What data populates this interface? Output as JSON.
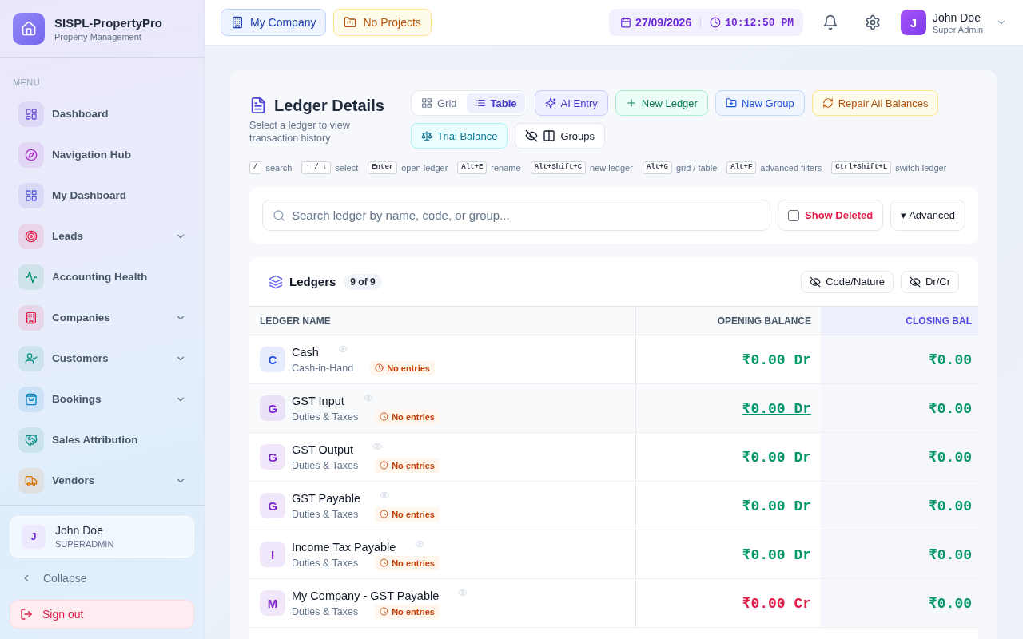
{
  "sidebar": {
    "brand": {
      "title": "SISPL-PropertyPro",
      "subtitle": "Property Management"
    },
    "section": "MENU",
    "items": [
      {
        "label": "Dashboard",
        "color": "#6d4fd8",
        "submenu": false,
        "selected": false
      },
      {
        "label": "Navigation Hub",
        "color": "#b02fc9",
        "submenu": false,
        "selected": false
      },
      {
        "label": "My Dashboard",
        "color": "#5b5bd6",
        "submenu": false,
        "selected": false
      },
      {
        "label": "Leads",
        "color": "#e11d48",
        "submenu": true,
        "selected": false
      },
      {
        "label": "Accounting Health",
        "color": "#059669",
        "submenu": false,
        "selected": false
      },
      {
        "label": "Companies",
        "color": "#e11d48",
        "submenu": true,
        "selected": false
      },
      {
        "label": "Customers",
        "color": "#0d9488",
        "submenu": true,
        "selected": false
      },
      {
        "label": "Bookings",
        "color": "#0284c7",
        "submenu": true,
        "selected": false
      },
      {
        "label": "Sales Attribution",
        "color": "#0d9488",
        "submenu": false,
        "selected": false
      },
      {
        "label": "Vendors",
        "color": "#d97706",
        "submenu": true,
        "selected": false
      }
    ],
    "user": {
      "initial": "J",
      "name": "John Doe",
      "role": "SUPERADMIN"
    },
    "collapse": "Collapse",
    "sign_out": "Sign out"
  },
  "topbar": {
    "company": "My Company",
    "project": "No Projects",
    "date": "27/09/2026",
    "time": "10:12:50 PM",
    "user": {
      "initial": "J",
      "name": "John Doe",
      "role": "Super Admin"
    }
  },
  "page": {
    "title": "Ledger Details",
    "subtitle": "Select a ledger to view transaction history",
    "view_modes": [
      {
        "label": "Grid",
        "kind": "grid",
        "selected": false
      },
      {
        "label": "Table",
        "kind": "table",
        "selected": true
      }
    ],
    "actions": [
      {
        "label": "AI Entry",
        "kind": "ai"
      },
      {
        "label": "New Ledger",
        "kind": "add"
      },
      {
        "label": "New Group",
        "kind": "folder"
      },
      {
        "label": "Repair All Balances",
        "kind": "repair"
      },
      {
        "label": "Trial Balance",
        "kind": "balance"
      }
    ],
    "groups_toggle": {
      "label": "Groups",
      "shown": false
    },
    "shortcuts": [
      {
        "key": "/",
        "label": "search"
      },
      {
        "key": "↑ / ↓",
        "label": "select"
      },
      {
        "key": "Enter",
        "label": "open ledger"
      },
      {
        "key": "Alt+E",
        "label": "rename"
      },
      {
        "key": "Alt+Shift+C",
        "label": "new ledger"
      },
      {
        "key": "Alt+G",
        "label": "grid / table"
      },
      {
        "key": "Alt+F",
        "label": "advanced filters"
      },
      {
        "key": "Ctrl+Shift+L",
        "label": "switch ledger"
      }
    ]
  },
  "filters": {
    "search": {
      "placeholder": "Search ledger by name, code, or group..."
    },
    "show_deleted": {
      "label": "Show Deleted",
      "checked": false
    },
    "advanced": "▾ Advanced"
  },
  "ledgers": {
    "title": "Ledgers",
    "count": "9 of 9",
    "column_toggles": [
      {
        "label": "Code/Nature",
        "shown": false
      },
      {
        "label": "Dr/Cr",
        "shown": false
      }
    ],
    "columns": [
      {
        "label": "LEDGER NAME",
        "highlighted": false
      },
      {
        "label": "OPENING BALANCE",
        "highlighted": false
      },
      {
        "label": "CLOSING BAL",
        "highlighted": true
      }
    ],
    "rows": [
      {
        "initial": "C",
        "color": "#1d4ed8",
        "name": "Cash",
        "group": "Cash-in-Hand",
        "status": "No entries",
        "opening": "₹0.00 Dr",
        "credit": false,
        "closing": "₹0.00",
        "hovered": false
      },
      {
        "initial": "G",
        "color": "#7e22ce",
        "name": "GST Input",
        "group": "Duties & Taxes",
        "status": "No entries",
        "opening": "₹0.00 Dr",
        "credit": false,
        "closing": "₹0.00",
        "hovered": true
      },
      {
        "initial": "G",
        "color": "#7e22ce",
        "name": "GST Output",
        "group": "Duties & Taxes",
        "status": "No entries",
        "opening": "₹0.00 Dr",
        "credit": false,
        "closing": "₹0.00",
        "hovered": false
      },
      {
        "initial": "G",
        "color": "#7e22ce",
        "name": "GST Payable",
        "group": "Duties & Taxes",
        "status": "No entries",
        "opening": "₹0.00 Dr",
        "credit": false,
        "closing": "₹0.00",
        "hovered": false
      },
      {
        "initial": "I",
        "color": "#7e22ce",
        "name": "Income Tax Payable",
        "group": "Duties & Taxes",
        "status": "No entries",
        "opening": "₹0.00 Dr",
        "credit": false,
        "closing": "₹0.00",
        "hovered": false
      },
      {
        "initial": "M",
        "color": "#7e22ce",
        "name": "My Company - GST Payable",
        "group": "Duties & Taxes",
        "status": "No entries",
        "opening": "₹0.00 Cr",
        "credit": true,
        "closing": "₹0.00",
        "hovered": false
      }
    ]
  }
}
